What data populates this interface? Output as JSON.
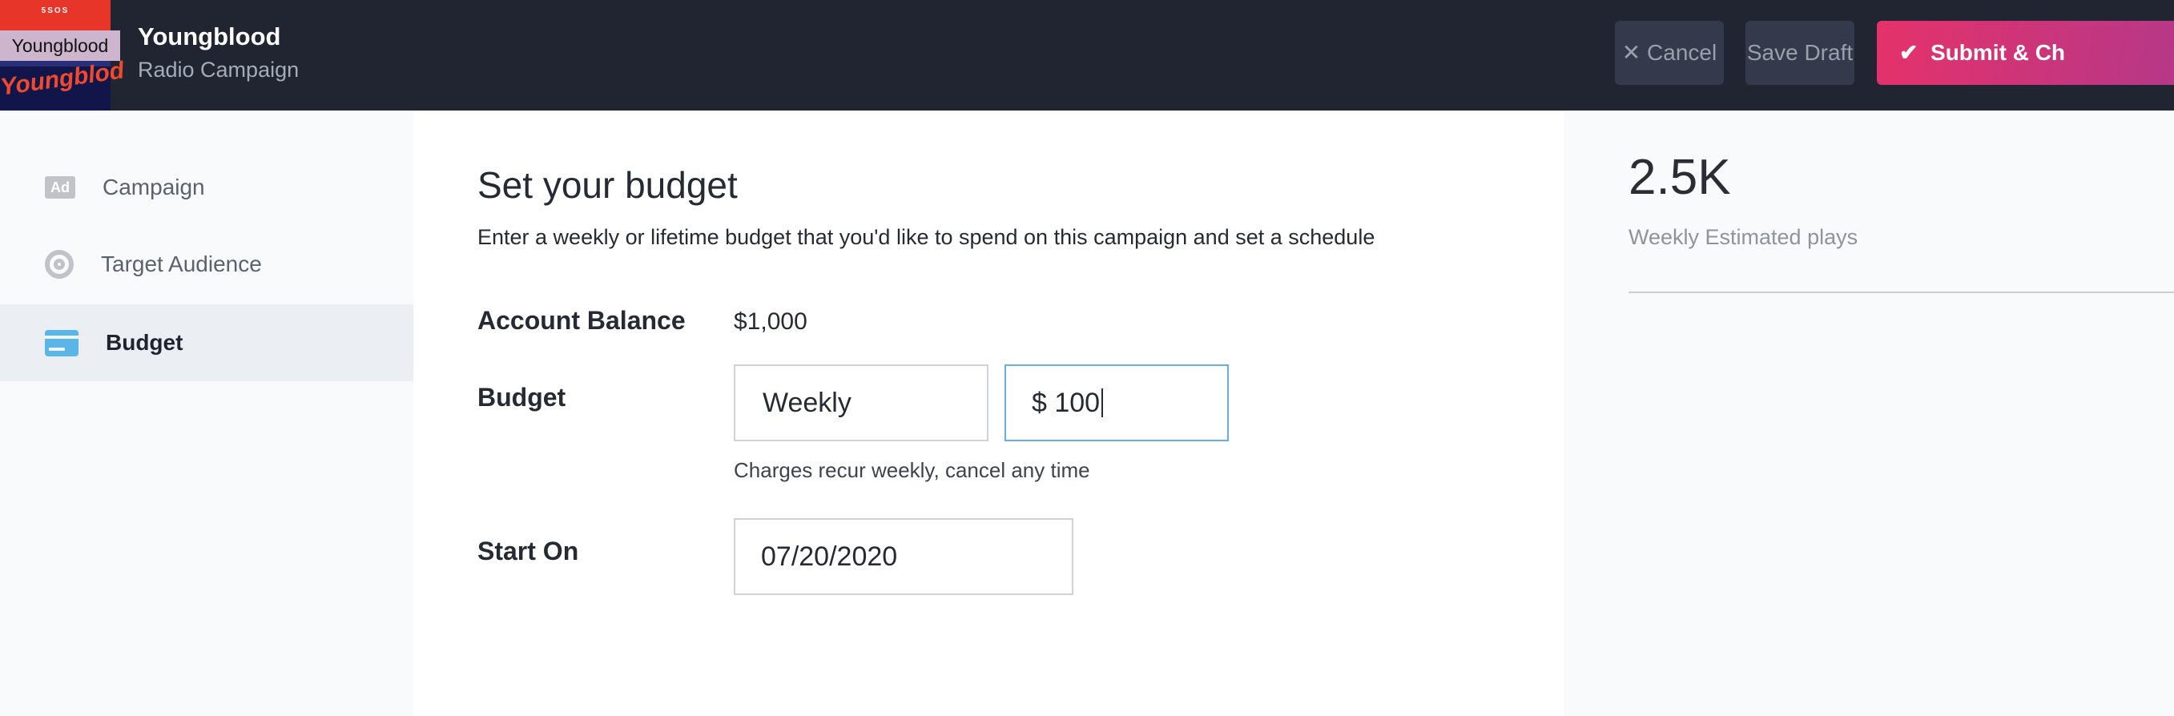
{
  "header": {
    "album_art": {
      "band": "5SOS",
      "script": "Youngblood"
    },
    "tooltip": "Youngblood",
    "title": "Youngblood",
    "subtitle": "Radio Campaign",
    "buttons": {
      "cancel": "Cancel",
      "save_draft": "Save Draft",
      "submit": "Submit & Ch"
    }
  },
  "sidebar": {
    "items": [
      {
        "label": "Campaign",
        "icon": "ad-icon"
      },
      {
        "label": "Target Audience",
        "icon": "target-icon"
      },
      {
        "label": "Budget",
        "icon": "credit-card-icon",
        "active": true
      }
    ]
  },
  "main": {
    "title": "Set your budget",
    "description": "Enter a weekly or lifetime budget that you'd like to spend on this campaign and set a schedule",
    "account_balance_label": "Account Balance",
    "account_balance": "$1,000",
    "budget_label": "Budget",
    "budget_type": "Weekly",
    "budget_amount": "$ 100",
    "budget_help": "Charges recur weekly, cancel any time",
    "start_label": "Start On",
    "start_date": "07/20/2020"
  },
  "summary": {
    "value": "2.5K",
    "label": "Weekly Estimated plays"
  },
  "colors": {
    "header_bg": "#212431",
    "accent": "#e5326a",
    "active_icon": "#5ab6e8"
  }
}
